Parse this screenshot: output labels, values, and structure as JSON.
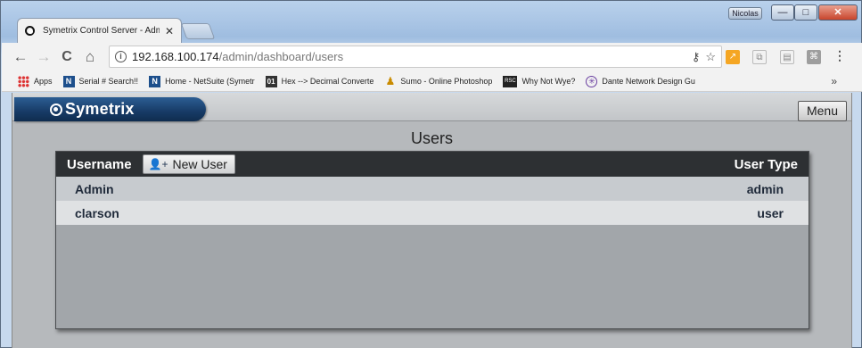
{
  "window": {
    "user_badge": "Nicolas",
    "minimize": "—",
    "maximize": "□",
    "close": "✕"
  },
  "tab": {
    "title": "Symetrix Control Server - Adm",
    "close": "✕"
  },
  "toolbar": {
    "back": "←",
    "forward": "→",
    "reload": "C",
    "home": "⌂",
    "url_host": "192.168.100.174",
    "url_path": "/admin/dashboard/users",
    "key_icon": "⚷",
    "star_icon": "☆",
    "menu": "⋮"
  },
  "bookmarks": {
    "items": [
      {
        "label": "Apps",
        "icon": "apps-icon"
      },
      {
        "label": "Serial # Search!!",
        "icon": "netsuite-icon"
      },
      {
        "label": "Home - NetSuite (Symetr",
        "icon": "netsuite-icon"
      },
      {
        "label": "Hex --> Decimal Converte",
        "icon": "hex-icon"
      },
      {
        "label": "Sumo - Online Photoshop",
        "icon": "sumo-icon"
      },
      {
        "label": "Why Not Wye?",
        "icon": "rsc-icon"
      },
      {
        "label": "Dante Network Design Gu",
        "icon": "dante-icon"
      }
    ],
    "more": "»"
  },
  "app": {
    "logo": "Symetrix",
    "menu_label": "Menu",
    "page_title": "Users"
  },
  "users_table": {
    "col_username": "Username",
    "new_user_label": "New User",
    "col_usertype": "User Type",
    "rows": [
      {
        "username": "Admin",
        "type": "admin"
      },
      {
        "username": "clarson",
        "type": "user"
      }
    ]
  }
}
